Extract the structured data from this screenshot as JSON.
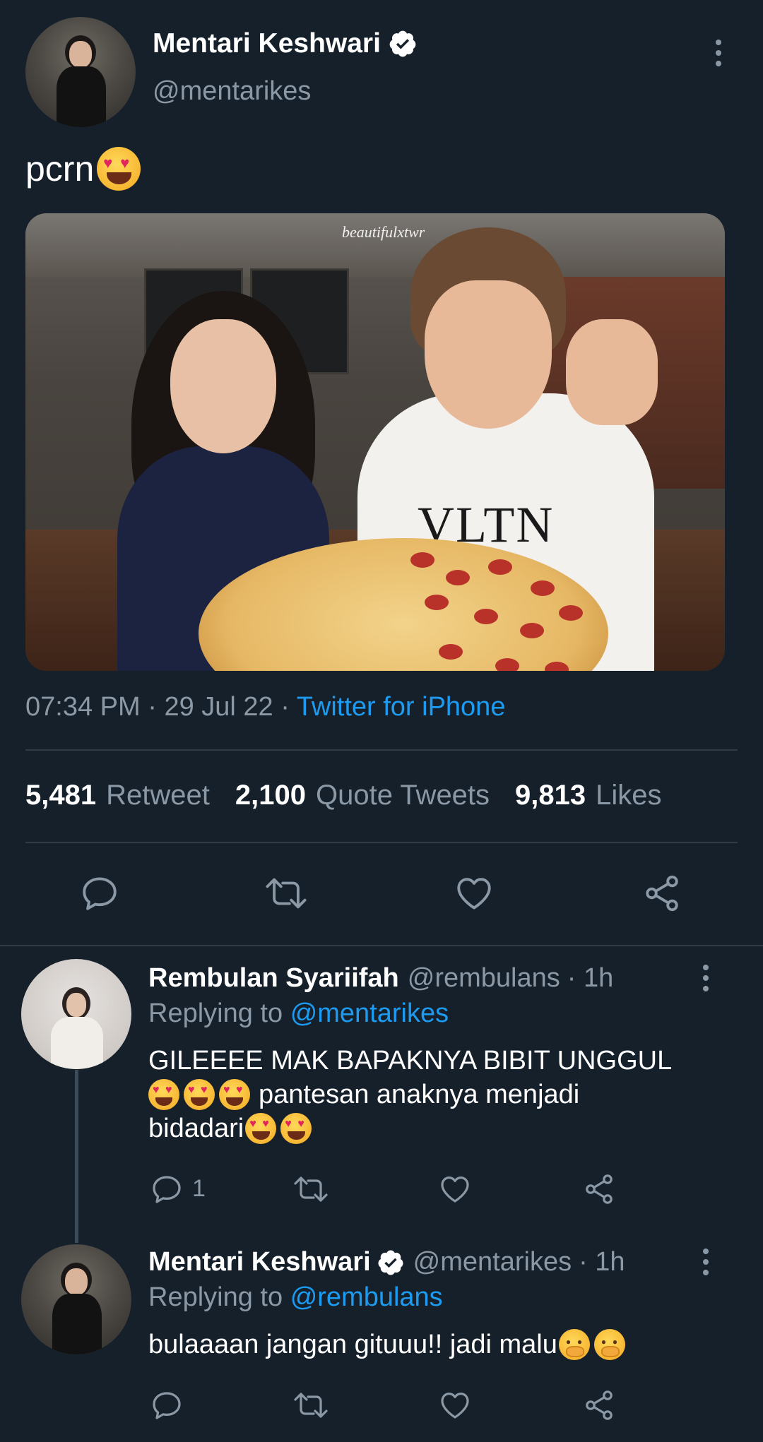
{
  "tweet": {
    "author_name": "Mentari Keshwari",
    "author_handle": "@mentarikes",
    "text": "pcrn",
    "text_emoji": "smiling-face-with-heart-eyes",
    "image_watermark": "beautifulxtwr",
    "image_shirt_text": "VLTN",
    "time": "07:34 PM",
    "date": "29 Jul 22",
    "separator": "·",
    "source": "Twitter for iPhone",
    "stats": {
      "retweets": "5,481",
      "retweets_label": "Retweet",
      "quotes": "2,100",
      "quotes_label": "Quote Tweets",
      "likes": "9,813",
      "likes_label": "Likes"
    },
    "actions": [
      "reply-icon",
      "retweet-icon",
      "like-icon",
      "share-icon"
    ]
  },
  "replies": [
    {
      "name": "Rembulan Syariifah",
      "handle": "@rembulans",
      "time": "· 1h",
      "replying_prefix": "Replying to",
      "replying_to": "@mentarikes",
      "line1": "GILEEEE MAK BAPAKNYA BIBIT UNGGUL",
      "line2": "pantesan anaknya menjadi",
      "line3": "bidadari",
      "reply_count": "1"
    },
    {
      "name": "Mentari Keshwari",
      "handle": "@mentarikes",
      "time": "· 1h",
      "replying_prefix": "Replying to",
      "replying_to": "@rembulans",
      "text": "bulaaaan jangan gituuu!! jadi malu",
      "text_emoji": "face-with-hand-over-mouth"
    }
  ],
  "colors": {
    "background": "#15202b",
    "accent": "#1d9bf0",
    "secondary_text": "#8b98a5",
    "divider": "#2f3b47"
  }
}
